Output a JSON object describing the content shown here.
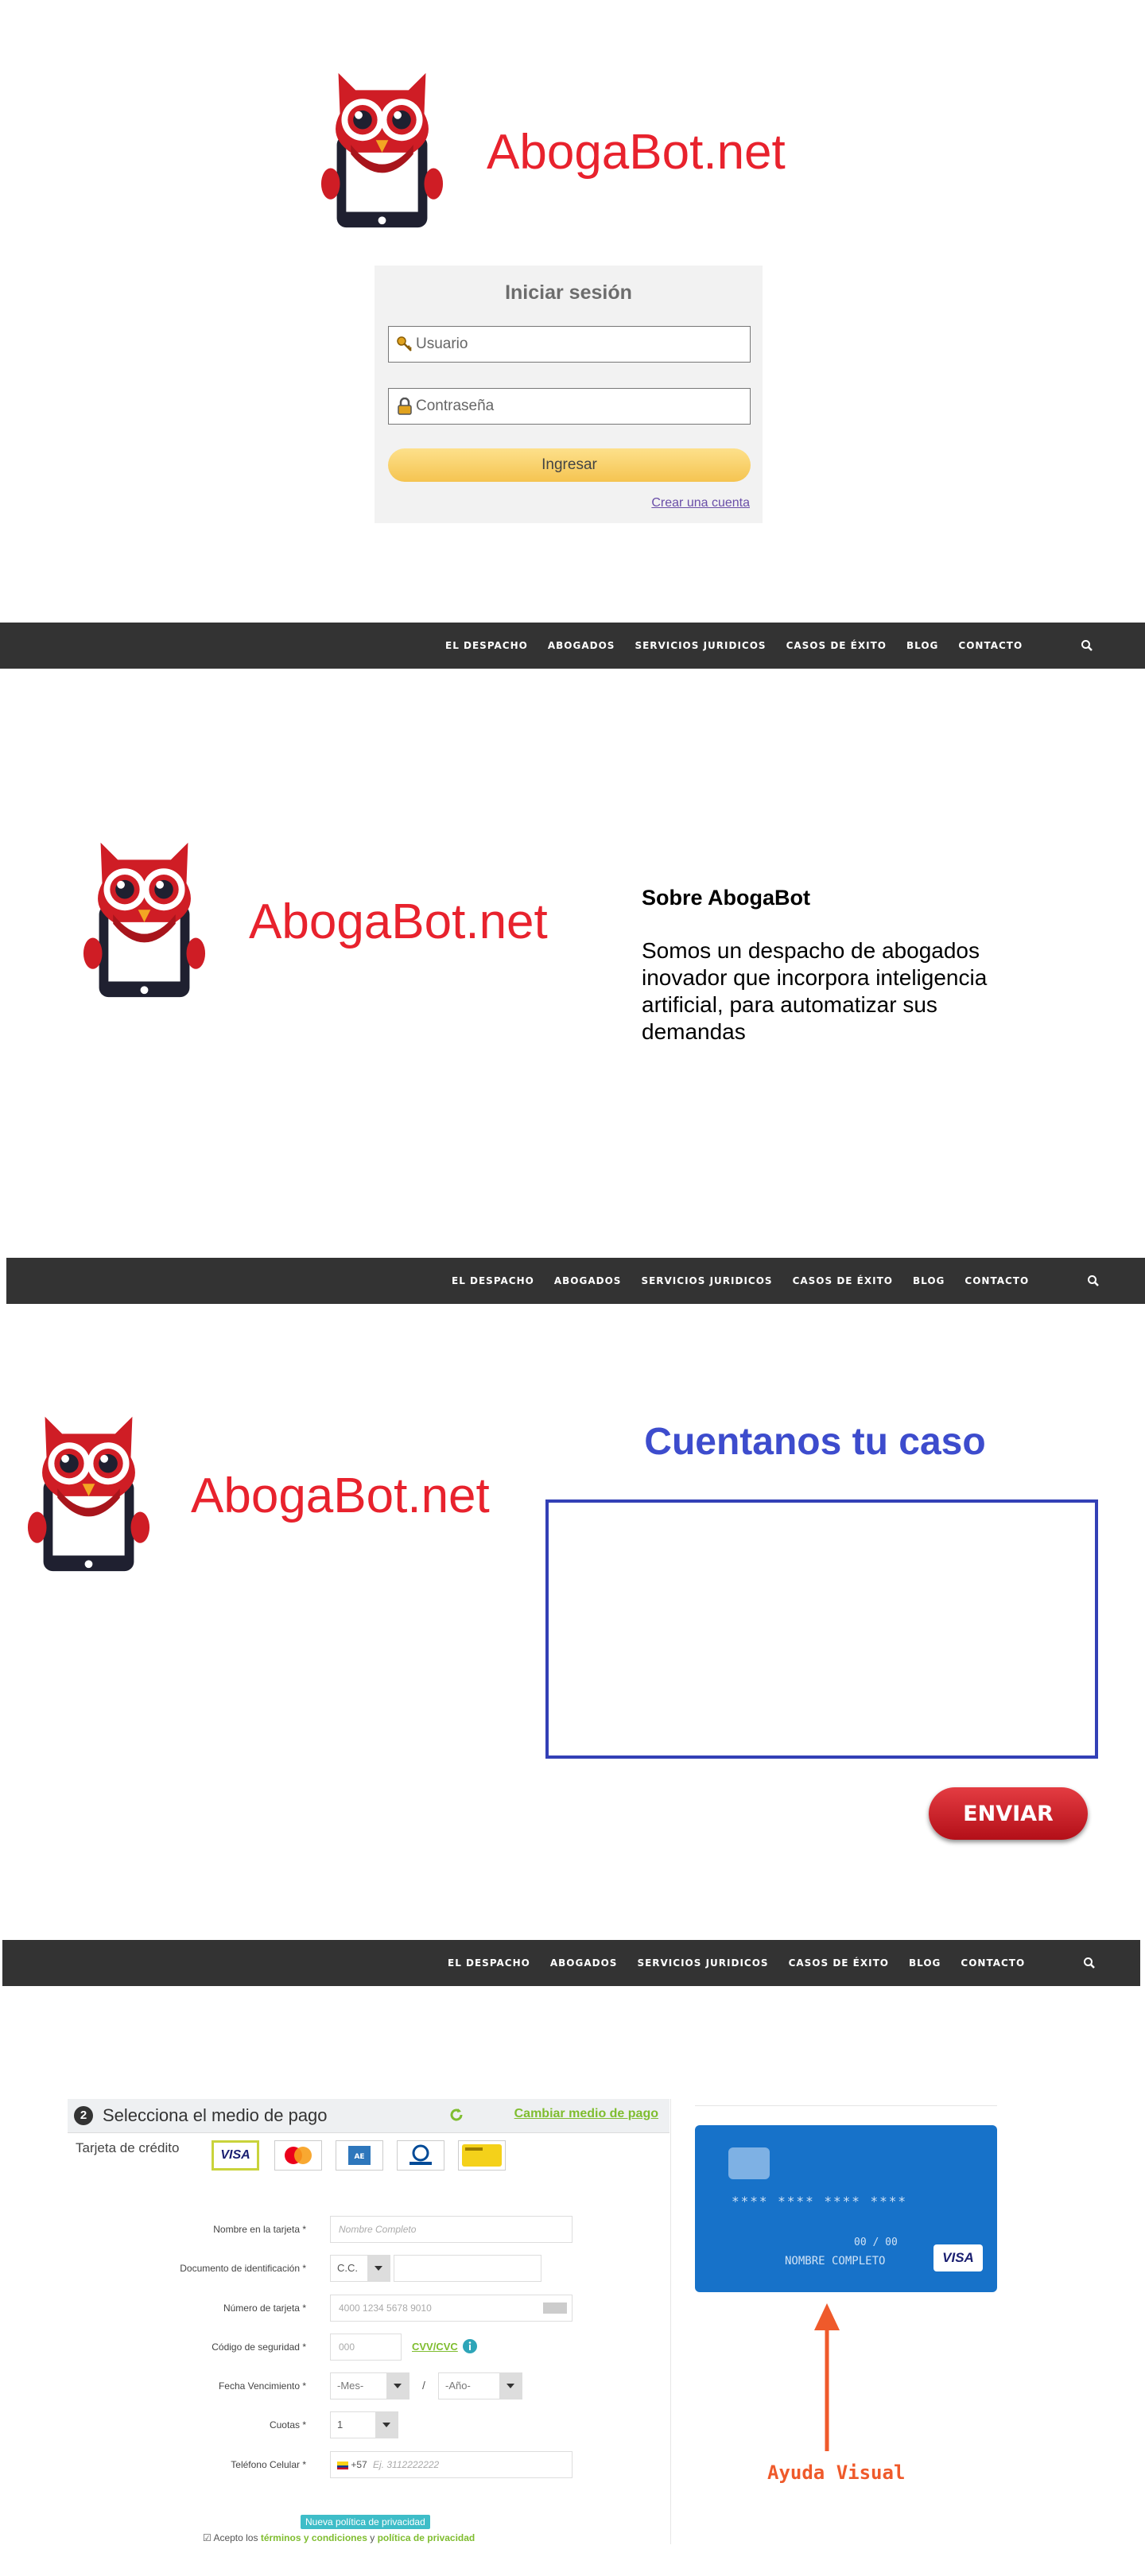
{
  "brand": {
    "name": "AbogaBot.net"
  },
  "login": {
    "title": "Iniciar sesión",
    "username_placeholder": "Usuario",
    "password_placeholder": "Contraseña",
    "submit_label": "Ingresar",
    "create_account_label": "Crear una cuenta"
  },
  "nav": {
    "items": [
      "EL DESPACHO",
      "ABOGADOS",
      "SERVICIOS JURIDICOS",
      "CASOS DE ÉXITO",
      "BLOG",
      "CONTACTO"
    ]
  },
  "about": {
    "title": "Sobre AbogaBot",
    "text": "Somos un despacho de abogados inovador que incorpora inteligencia artificial, para automatizar sus demandas"
  },
  "contact": {
    "title": "Cuentanos tu caso",
    "send_label": "ENVIAR"
  },
  "payment": {
    "step_number": "2",
    "title": "Selecciona el medio de pago",
    "change_label": "Cambiar medio de pago",
    "credit_card_label": "Tarjeta de crédito",
    "cards": [
      "VISA",
      "MasterCard",
      "AMEX",
      "Diners Club",
      "CODENSA"
    ],
    "fields": {
      "name_label": "Nombre en la tarjeta *",
      "name_placeholder": "Nombre Completo",
      "doc_label": "Documento de identificación *",
      "doc_type": "C.C.",
      "card_number_label": "Número de tarjeta *",
      "card_number_placeholder": "4000 1234 5678 9010",
      "cvv_label": "Código de seguridad *",
      "cvv_placeholder": "000",
      "cvv_help": "CVV/CVC",
      "expiry_label": "Fecha Vencimiento *",
      "month_placeholder": "-Mes-",
      "separator": "/",
      "year_placeholder": "-Año-",
      "installments_label": "Cuotas *",
      "installments_value": "1",
      "phone_label": "Teléfono Celular *",
      "phone_prefix": "+57",
      "phone_placeholder": "Ej. 3112222222"
    },
    "privacy_badge": "Nueva política de privacidad",
    "terms_prefix": "Acepto los",
    "terms_link": "términos y condiciones",
    "terms_and": "y",
    "privacy_link": "política de privacidad"
  },
  "visual_card": {
    "number": "**** **** **** ****",
    "expiry": "00 / 00",
    "holder": "NOMBRE COMPLETO",
    "network": "VISA"
  },
  "visual_help_label": "Ayuda Visual",
  "colors": {
    "brand_red": "#e8222d",
    "nav_bg": "#333333",
    "contact_blue": "#3d4ccd",
    "card_blue": "#1772c9",
    "accent_green": "#7fbd2f",
    "annotation_orange": "#ef5a2b"
  }
}
